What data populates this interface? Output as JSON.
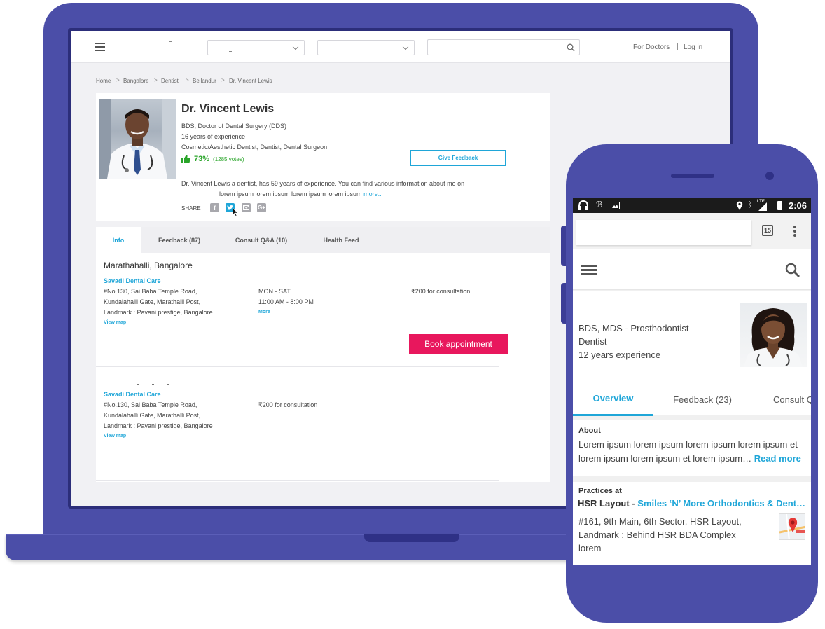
{
  "desktop": {
    "header": {
      "links": {
        "for_doctors": "For Doctors",
        "separator": "|",
        "login": "Log in"
      }
    },
    "breadcrumb": [
      "Home",
      "Bangalore",
      "Dentist",
      "Bellandur",
      "Dr. Vincent Lewis"
    ],
    "breadcrumb_sep": ">",
    "profile": {
      "name": "Dr. Vincent Lewis",
      "qualification": "BDS, Doctor of Dental Surgery (DDS)",
      "experience": "16 years of experience",
      "specialities": "Cosmetic/Aesthetic Dentist, Dentist, Dental Surgeon",
      "rating_percent": "73%",
      "votes": "(1285 votes)",
      "bio_line1": "Dr. Vincent Lewis a dentist, has 59 years of experience. You can find various information about me on",
      "bio_line2": "lorem ipsum lorem ipsum lorem ipsum lorem ipsum",
      "bio_more": "more..",
      "share_label": "SHARE",
      "give_feedback": "Give Feedback"
    },
    "tabs": [
      {
        "label": "Info"
      },
      {
        "label": "Feedback (87)"
      },
      {
        "label": "Consult Q&A (10)"
      },
      {
        "label": "Health Feed"
      }
    ],
    "clinic1": {
      "location": "Marathahalli, Bangalore",
      "name": "Savadi Dental Care",
      "address1": "#No.130, Sai Baba Temple Road,",
      "address2": "Kundalahalli Gate, Marathalli Post,",
      "address3": "Landmark : Pavani prestige, Bangalore",
      "view_map": "View map",
      "days": "MON - SAT",
      "hours": "11:00 AM - 8:00 PM",
      "more": "More",
      "fee": "₹200 for consultation",
      "book": "Book appointment"
    },
    "clinic2": {
      "name": "Savadi Dental Care",
      "address1": "#No.130, Sai Baba Temple Road,",
      "address2": "Kundalahalli Gate, Marathalli Post,",
      "address3": "Landmark : Pavani prestige, Bangalore",
      "view_map": "View map",
      "fee": "₹200 for consultation"
    }
  },
  "mobile": {
    "status": {
      "time": "2:06",
      "network": "LTE"
    },
    "browser": {
      "tab_count": "15"
    },
    "profile": {
      "qualification": "BDS, MDS - Prosthodontist",
      "speciality": "Dentist",
      "experience": "12 years experience"
    },
    "tabs": [
      {
        "label": "Overview"
      },
      {
        "label": "Feedback (23)"
      },
      {
        "label": "Consult Q"
      }
    ],
    "about": {
      "heading": "About",
      "line1": "Lorem ipsum lorem ipsum lorem ipsum lorem ipsum et",
      "line2": "lorem ipsum lorem ipsum et lorem ipsum…",
      "read_more": "Read more"
    },
    "practice": {
      "heading": "Practices at",
      "area": "HSR Layout -",
      "clinic": "Smiles ‘N’ More Orthodontics & Dent…",
      "address1": "#161,  9th Main, 6th Sector, HSR Layout,",
      "address2": "Landmark : Behind HSR BDA Complex",
      "address3": "lorem"
    }
  },
  "colors": {
    "device": "#4b4ea8",
    "accent_blue": "#1fa6d8",
    "book_pink": "#e8175d",
    "rating_green": "#2aa52a"
  },
  "icons": [
    "menu-icon",
    "search-icon",
    "thumbs-up-icon",
    "facebook-icon",
    "twitter-icon",
    "mail-icon",
    "google-plus-icon",
    "kebab-menu-icon",
    "map-pin-icon"
  ]
}
